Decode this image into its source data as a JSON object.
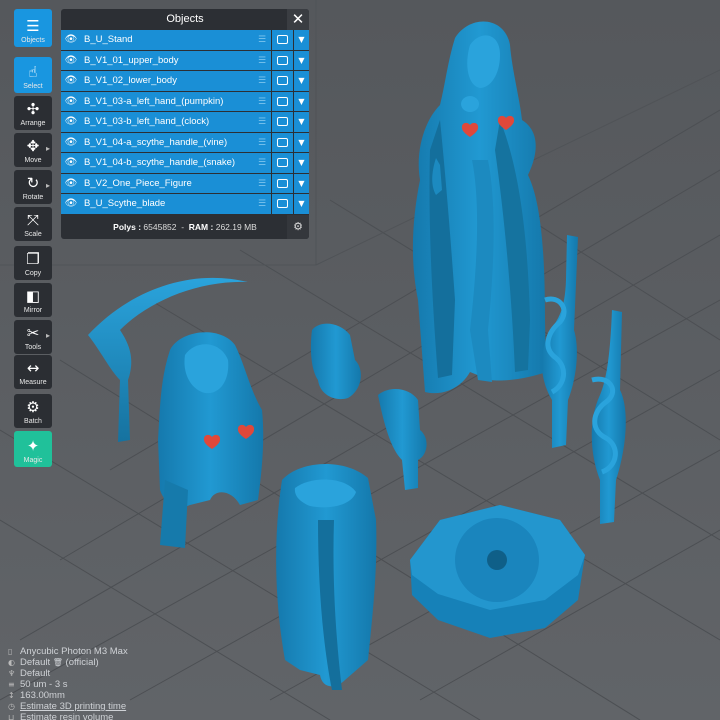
{
  "toolbar": {
    "objects": {
      "label": "Objects",
      "icon": "list-icon"
    },
    "select": {
      "label": "Select",
      "icon": "pointer-hand-icon"
    },
    "arrange": {
      "label": "Arrange",
      "icon": "arrange-icon"
    },
    "move": {
      "label": "Move",
      "icon": "move-arrows-icon"
    },
    "rotate": {
      "label": "Rotate",
      "icon": "rotate-icon"
    },
    "scale": {
      "label": "Scale",
      "icon": "scale-icon"
    },
    "copy": {
      "label": "Copy",
      "icon": "copy-icon"
    },
    "mirror": {
      "label": "Mirror",
      "icon": "mirror-icon"
    },
    "tools": {
      "label": "Tools",
      "icon": "scissors-icon"
    },
    "measure": {
      "label": "Measure",
      "icon": "measure-arrows-icon"
    },
    "batch": {
      "label": "Batch",
      "icon": "batch-icon"
    },
    "magic": {
      "label": "Magic",
      "icon": "magic-wand-icon"
    }
  },
  "objects_panel": {
    "title": "Objects",
    "items": [
      {
        "name": "B_U_Stand"
      },
      {
        "name": "B_V1_01_upper_body"
      },
      {
        "name": "B_V1_02_lower_body"
      },
      {
        "name": "B_V1_03-a_left_hand_(pumpkin)"
      },
      {
        "name": "B_V1_03-b_left_hand_(clock)"
      },
      {
        "name": "B_V1_04-a_scythe_handle_(vine)"
      },
      {
        "name": "B_V1_04-b_scythe_handle_(snake)"
      },
      {
        "name": "B_V2_One_Piece_Figure"
      },
      {
        "name": "B_U_Scythe_blade"
      }
    ],
    "footer": {
      "polys_label": "Polys :",
      "polys_value": "6545852",
      "ram_label": "RAM :",
      "ram_value": "262.19 MB"
    }
  },
  "info": {
    "printer": "Anycubic Photon M3 Max",
    "profile": "Default",
    "profile_suffix": "(official)",
    "support": "Default",
    "time": "50 um - 3 s",
    "height": "163.00mm",
    "estimate_time": "Estimate 3D printing time",
    "estimate_resin": "Estimate resin volume"
  },
  "colors": {
    "model": "#1f8cc4",
    "model_highlight": "#3fb0e6",
    "accent": "#1996e0",
    "magic": "#20c19a",
    "heart": "#e0483a",
    "background": "#5a5d61"
  }
}
